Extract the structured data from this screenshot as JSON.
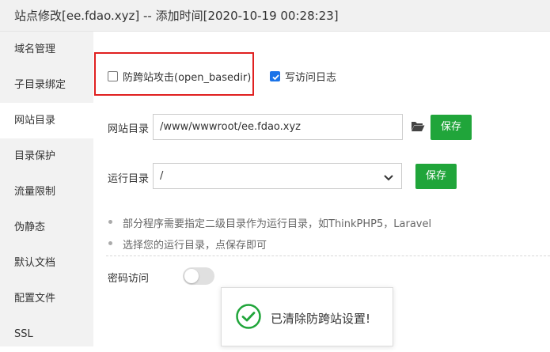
{
  "window": {
    "title": "站点修改[ee.fdao.xyz] -- 添加时间[2020-10-19 00:28:23]"
  },
  "sidebar": {
    "items": [
      {
        "label": "域名管理",
        "active": false
      },
      {
        "label": "子目录绑定",
        "active": false
      },
      {
        "label": "网站目录",
        "active": true
      },
      {
        "label": "目录保护",
        "active": false
      },
      {
        "label": "流量限制",
        "active": false
      },
      {
        "label": "伪静态",
        "active": false
      },
      {
        "label": "默认文档",
        "active": false
      },
      {
        "label": "配置文件",
        "active": false
      },
      {
        "label": "SSL",
        "active": false
      }
    ]
  },
  "options": {
    "anti_xss": {
      "label": "防跨站攻击(open_basedir)",
      "checked": false
    },
    "access_log": {
      "label": "写访问日志",
      "checked": true
    }
  },
  "site_dir": {
    "label": "网站目录",
    "value": "/www/wwwroot/ee.fdao.xyz",
    "save_label": "保存"
  },
  "run_dir": {
    "label": "运行目录",
    "value": "/",
    "save_label": "保存"
  },
  "tips": [
    "部分程序需要指定二级目录作为运行目录，如ThinkPHP5，Laravel",
    "选择您的运行目录，点保存即可"
  ],
  "password_access": {
    "label": "密码访问",
    "enabled": false
  },
  "toast": {
    "message": "已清除防跨站设置!"
  },
  "colors": {
    "accent_green": "#20a53a",
    "highlight_red": "#e02020",
    "checkbox_blue": "#1a73e8"
  }
}
